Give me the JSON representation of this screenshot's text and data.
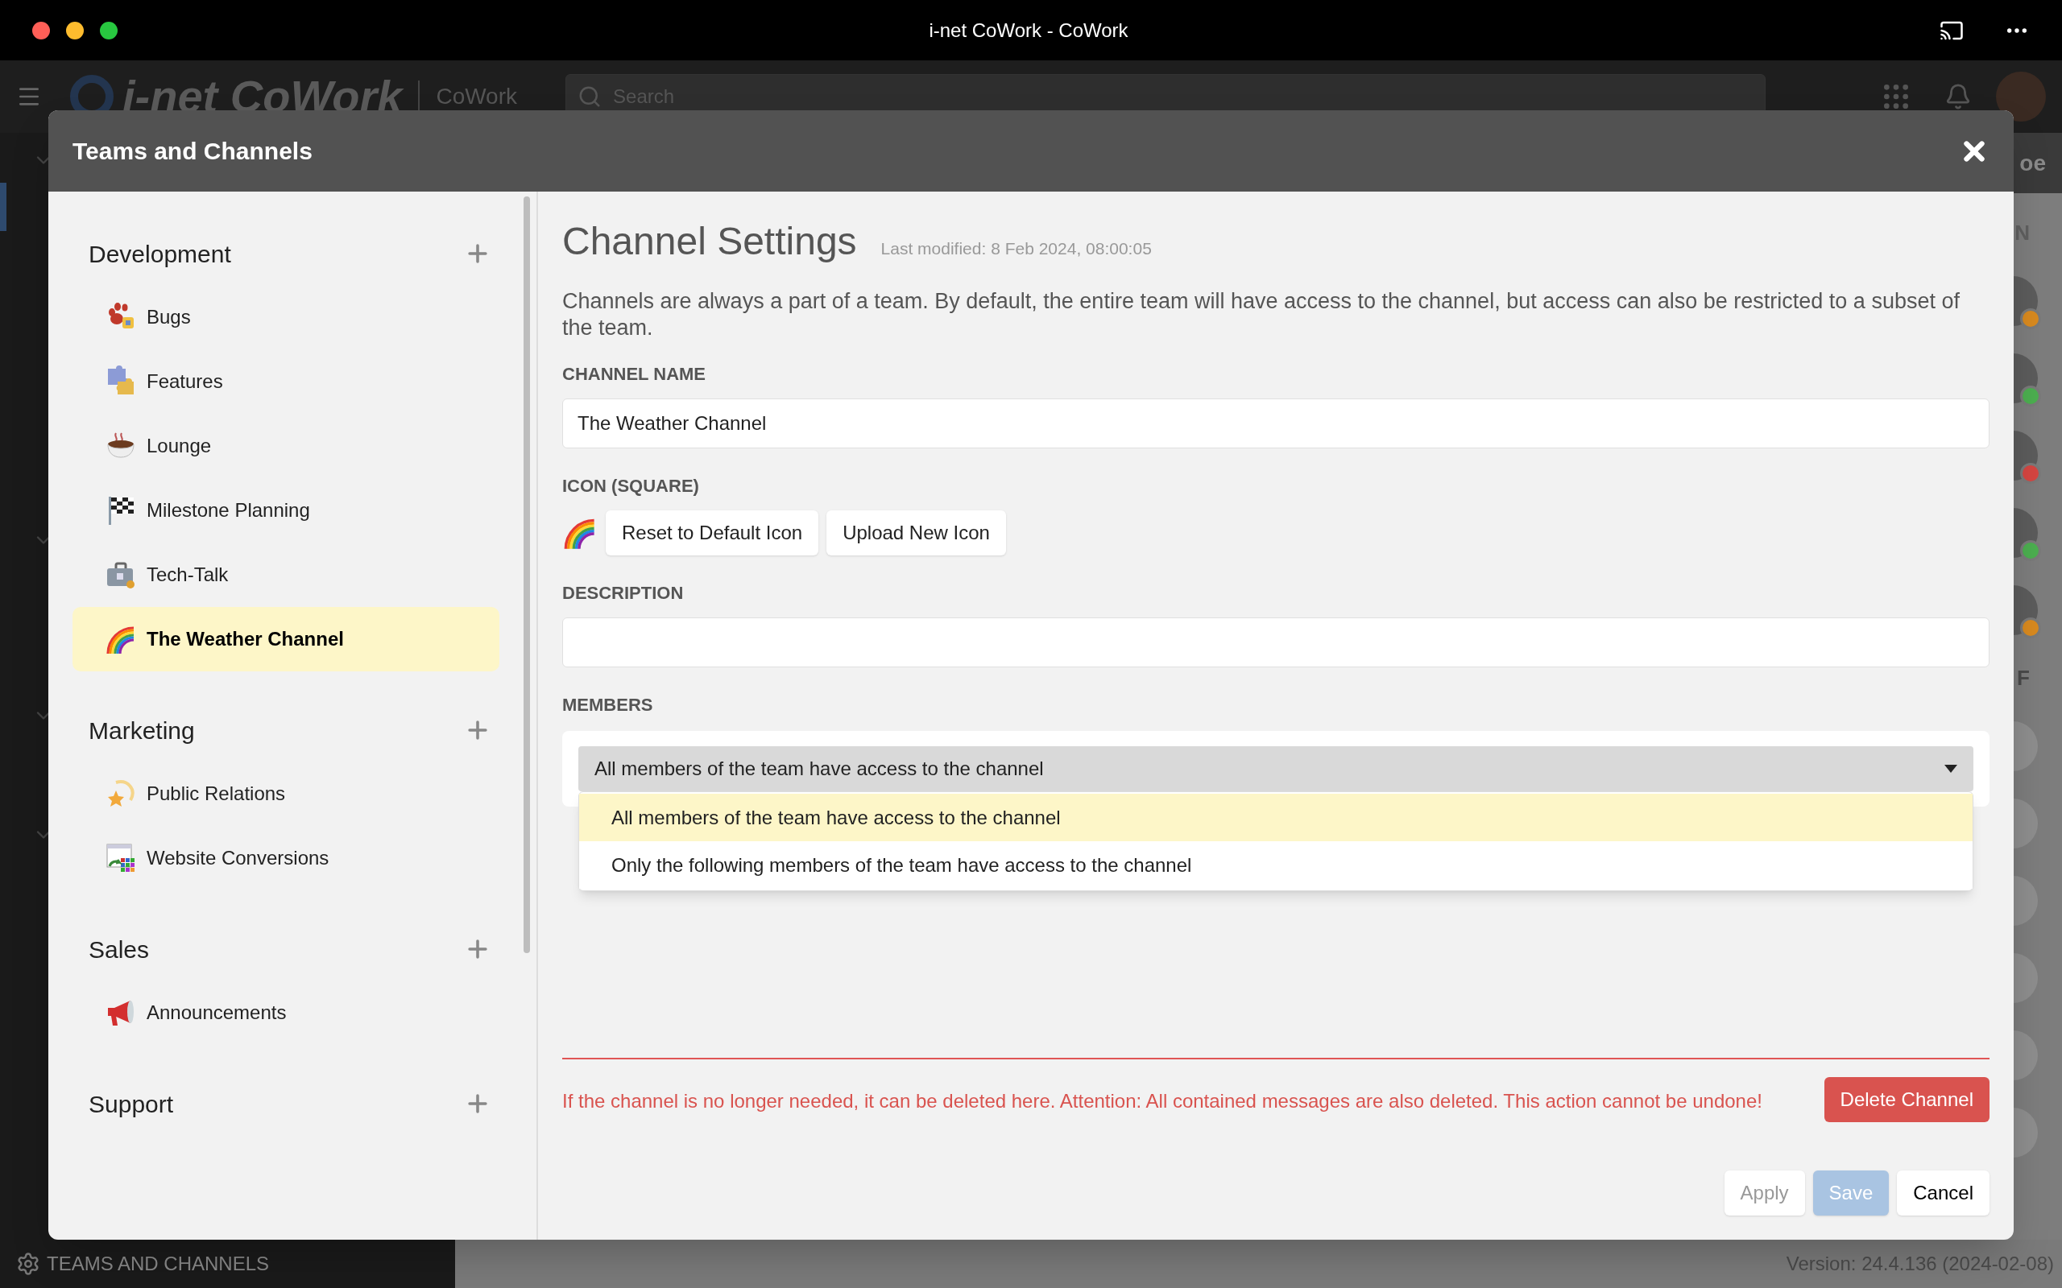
{
  "window": {
    "title": "i-net CoWork - CoWork"
  },
  "app_header": {
    "logo": "i-net CoWork",
    "app_name": "CoWork",
    "search": {
      "placeholder": "Search"
    }
  },
  "background": {
    "panel_title_fragment": "oe",
    "section_letters": [
      "N",
      "F"
    ],
    "avatars": [
      {
        "color": "#d98a1f"
      },
      {
        "color": "#4caf50"
      },
      {
        "color": "#d64541"
      },
      {
        "color": "#4caf50"
      },
      {
        "color": "#d98a1f"
      }
    ]
  },
  "dialog": {
    "title": "Teams and Channels",
    "teams": [
      {
        "name": "Development",
        "channels": [
          {
            "name": "Bugs",
            "selected": false
          },
          {
            "name": "Features",
            "selected": false
          },
          {
            "name": "Lounge",
            "selected": false
          },
          {
            "name": "Milestone Planning",
            "selected": false
          },
          {
            "name": "Tech-Talk",
            "selected": false
          },
          {
            "name": "The Weather Channel",
            "selected": true
          }
        ]
      },
      {
        "name": "Marketing",
        "channels": [
          {
            "name": "Public Relations",
            "selected": false
          },
          {
            "name": "Website Conversions",
            "selected": false
          }
        ]
      },
      {
        "name": "Sales",
        "channels": [
          {
            "name": "Announcements",
            "selected": false
          }
        ]
      },
      {
        "name": "Support"
      }
    ],
    "settings": {
      "title": "Channel Settings",
      "last_modified": "Last modified: 8 Feb 2024, 08:00:05",
      "intro": "Channels are always a part of a team. By default, the entire team will have access to the channel, but access can also be restricted to a subset of the team.",
      "name_label": "CHANNEL NAME",
      "name_value": "The Weather Channel",
      "icon_label": "ICON (SQUARE)",
      "icon_buttons": [
        "Reset to Default Icon",
        "Upload New Icon"
      ],
      "description_label": "DESCRIPTION",
      "members": {
        "label": "MEMBERS",
        "value": "All members of the team have access to the channel",
        "expanded": true,
        "options": [
          {
            "label": "All members of the team have access to the channel",
            "selected": true
          },
          {
            "label": "Only the following members of the team have access to the channel",
            "selected": false
          }
        ]
      },
      "delete_warning": "If the channel is no longer needed, it can be deleted here. Attention: All contained messages are also deleted. This action cannot be undone!",
      "delete_button": "Delete Channel"
    },
    "buttons": [
      {
        "label": "Apply",
        "kind": "secondary",
        "disabled": true
      },
      {
        "label": "Save",
        "kind": "primary",
        "disabled": true
      },
      {
        "label": "Cancel",
        "kind": "secondary",
        "disabled": false
      }
    ]
  },
  "status_bar": {
    "section": "TEAMS AND CHANNELS",
    "version": "Version: 24.4.136 (2024-02-08)"
  }
}
